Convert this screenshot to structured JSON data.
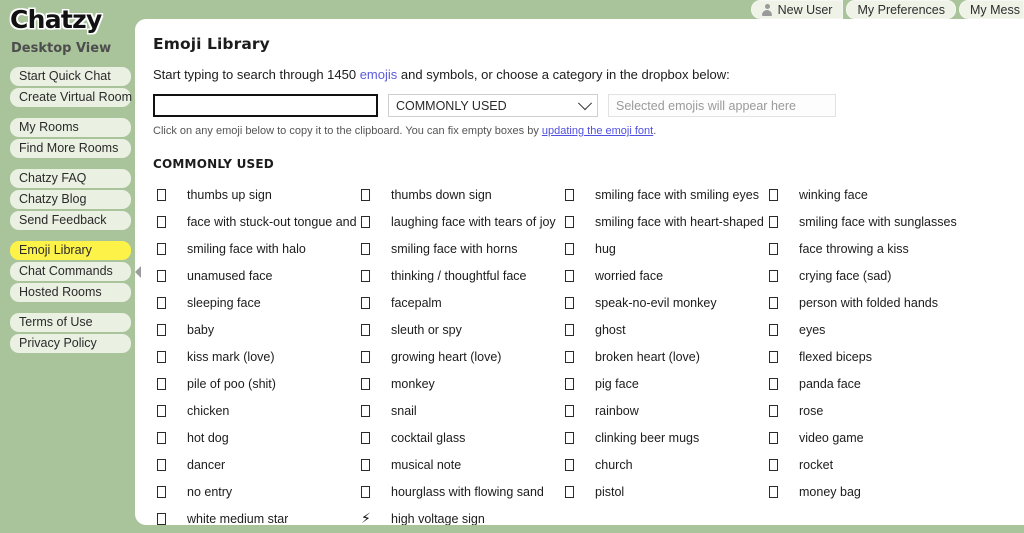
{
  "brand": {
    "logo": "Chatzy",
    "view_label": "Desktop View"
  },
  "topnav": {
    "items": [
      {
        "label": "New User",
        "icon": "person-icon"
      },
      {
        "label": "My Preferences",
        "icon": null
      },
      {
        "label": "My Mess",
        "icon": null
      }
    ]
  },
  "sidebar": {
    "groups": [
      {
        "items": [
          {
            "label": "Start Quick Chat",
            "active": false
          },
          {
            "label": "Create Virtual Room",
            "active": false
          }
        ]
      },
      {
        "items": [
          {
            "label": "My Rooms",
            "active": false
          },
          {
            "label": "Find More Rooms",
            "active": false
          }
        ]
      },
      {
        "items": [
          {
            "label": "Chatzy FAQ",
            "active": false
          },
          {
            "label": "Chatzy Blog",
            "active": false
          },
          {
            "label": "Send Feedback",
            "active": false
          }
        ]
      },
      {
        "items": [
          {
            "label": "Emoji Library",
            "active": true
          },
          {
            "label": "Chat Commands",
            "active": false
          },
          {
            "label": "Hosted Rooms",
            "active": false
          }
        ]
      },
      {
        "items": [
          {
            "label": "Terms of Use",
            "active": false
          },
          {
            "label": "Privacy Policy",
            "active": false
          }
        ]
      }
    ]
  },
  "main": {
    "title": "Emoji Library",
    "intro": {
      "before_count": "Start typing to search through ",
      "count": "1450",
      "link": "emojis",
      "after": " and symbols, or choose a category in the dropbox below:"
    },
    "search": {
      "value": "",
      "placeholder": ""
    },
    "category": {
      "selected": "COMMONLY USED",
      "icon": "chevron-down-icon"
    },
    "selected_emojis": {
      "placeholder": "Selected emojis will appear here"
    },
    "hint": {
      "before": "Click on any emoji below to copy it to the clipboard. You can fix empty boxes by ",
      "link": "updating the emoji font",
      "after": "."
    },
    "section_title": "COMMONLY USED",
    "emojis": [
      {
        "label": "thumbs up sign",
        "glyph": "tofu"
      },
      {
        "label": "thumbs down sign",
        "glyph": "tofu"
      },
      {
        "label": "smiling face with smiling eyes",
        "glyph": "tofu"
      },
      {
        "label": "winking face",
        "glyph": "tofu"
      },
      {
        "label": "face with stuck-out tongue and tightly-closed eyes",
        "glyph": "tofu"
      },
      {
        "label": "laughing face with tears of joy",
        "glyph": "tofu"
      },
      {
        "label": "smiling face with heart-shaped eyes",
        "glyph": "tofu"
      },
      {
        "label": "smiling face with sunglasses",
        "glyph": "tofu"
      },
      {
        "label": "smiling face with halo",
        "glyph": "tofu"
      },
      {
        "label": "smiling face with horns",
        "glyph": "tofu"
      },
      {
        "label": "hug",
        "glyph": "tofu"
      },
      {
        "label": "face throwing a kiss",
        "glyph": "tofu"
      },
      {
        "label": "unamused face",
        "glyph": "tofu"
      },
      {
        "label": "thinking / thoughtful face",
        "glyph": "tofu"
      },
      {
        "label": "worried face",
        "glyph": "tofu"
      },
      {
        "label": "crying face (sad)",
        "glyph": "tofu"
      },
      {
        "label": "sleeping face",
        "glyph": "tofu"
      },
      {
        "label": "facepalm",
        "glyph": "tofu"
      },
      {
        "label": "speak-no-evil monkey",
        "glyph": "tofu"
      },
      {
        "label": "person with folded hands",
        "glyph": "tofu"
      },
      {
        "label": "baby",
        "glyph": "tofu"
      },
      {
        "label": "sleuth or spy",
        "glyph": "tofu"
      },
      {
        "label": "ghost",
        "glyph": "tofu"
      },
      {
        "label": "eyes",
        "glyph": "tofu"
      },
      {
        "label": "kiss mark (love)",
        "glyph": "tofu"
      },
      {
        "label": "growing heart (love)",
        "glyph": "tofu"
      },
      {
        "label": "broken heart (love)",
        "glyph": "tofu"
      },
      {
        "label": "flexed biceps",
        "glyph": "tofu"
      },
      {
        "label": "pile of poo (shit)",
        "glyph": "tofu"
      },
      {
        "label": "monkey",
        "glyph": "tofu"
      },
      {
        "label": "pig face",
        "glyph": "tofu"
      },
      {
        "label": "panda face",
        "glyph": "tofu"
      },
      {
        "label": "chicken",
        "glyph": "tofu"
      },
      {
        "label": "snail",
        "glyph": "tofu"
      },
      {
        "label": "rainbow",
        "glyph": "tofu"
      },
      {
        "label": "rose",
        "glyph": "tofu"
      },
      {
        "label": "hot dog",
        "glyph": "tofu"
      },
      {
        "label": "cocktail glass",
        "glyph": "tofu"
      },
      {
        "label": "clinking beer mugs",
        "glyph": "tofu"
      },
      {
        "label": "video game",
        "glyph": "tofu"
      },
      {
        "label": "dancer",
        "glyph": "tofu"
      },
      {
        "label": "musical note",
        "glyph": "tofu"
      },
      {
        "label": "church",
        "glyph": "tofu"
      },
      {
        "label": "rocket",
        "glyph": "tofu"
      },
      {
        "label": "no entry",
        "glyph": "tofu"
      },
      {
        "label": "hourglass with flowing sand",
        "glyph": "tofu"
      },
      {
        "label": "pistol",
        "glyph": "tofu"
      },
      {
        "label": "money bag",
        "glyph": "tofu"
      },
      {
        "label": "white medium star",
        "glyph": "tofu"
      },
      {
        "label": "high voltage sign",
        "glyph": "⚡"
      }
    ]
  },
  "colors": {
    "page_green": "#a9c49b",
    "panel_white": "#ffffff",
    "nav_pill": "#eaf0e2",
    "active_highlight": "#fdf348",
    "link": "#5c5cdd"
  }
}
